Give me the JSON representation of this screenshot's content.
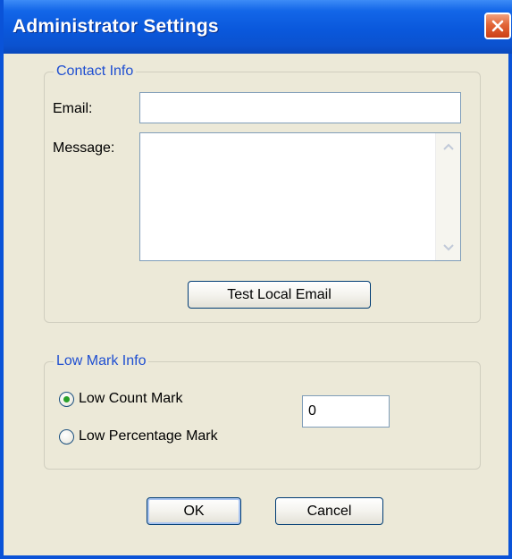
{
  "window": {
    "title": "Administrator Settings"
  },
  "contact": {
    "legend": "Contact Info",
    "email_label": "Email:",
    "email_value": "",
    "message_label": "Message:",
    "message_value": "",
    "test_button": "Test Local Email"
  },
  "lowmark": {
    "legend": "Low Mark Info",
    "options": [
      {
        "label": "Low Count Mark",
        "selected": true
      },
      {
        "label": "Low Percentage Mark",
        "selected": false
      }
    ],
    "value": "0"
  },
  "buttons": {
    "ok": "OK",
    "cancel": "Cancel"
  },
  "colors": {
    "titlebar": "#0a58dc",
    "dialog_bg": "#ece9d8",
    "legend_text": "#1f4fd1",
    "close_button": "#e26536"
  },
  "icons": {
    "close": "close-icon",
    "scroll_up": "scroll-up-arrow-icon",
    "scroll_down": "scroll-down-arrow-icon"
  }
}
